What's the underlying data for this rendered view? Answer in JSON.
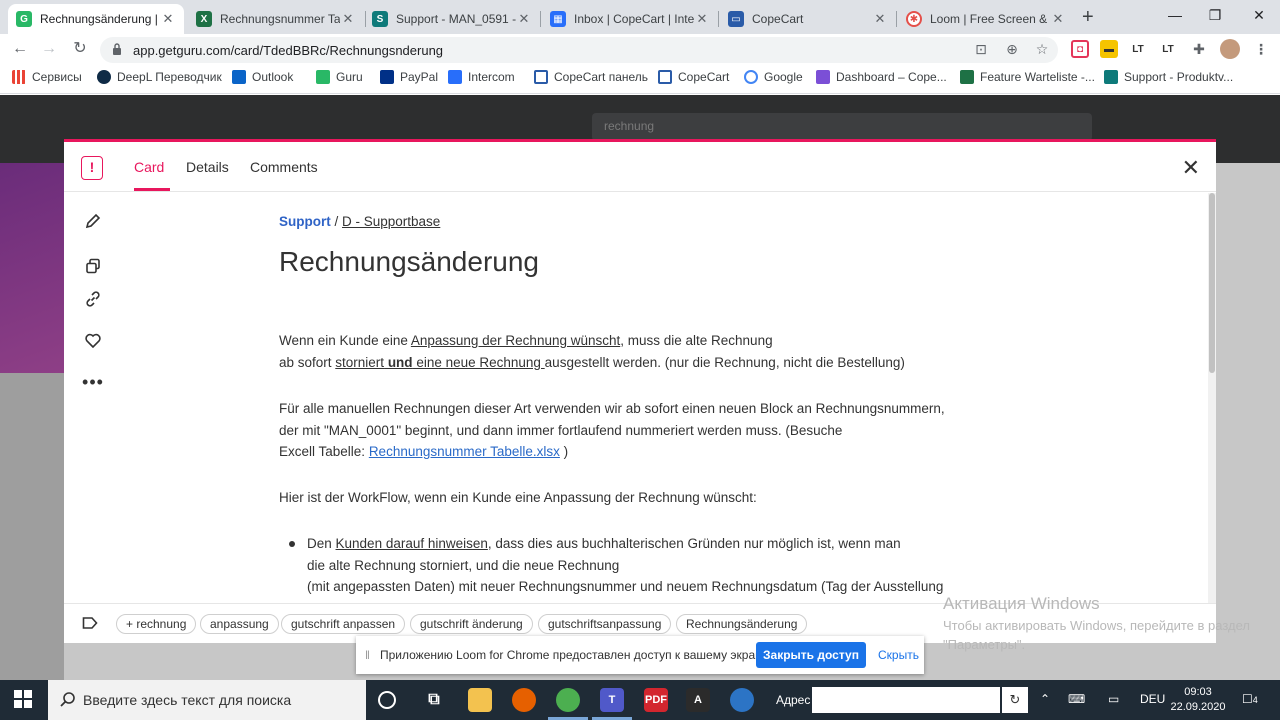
{
  "browser": {
    "tabs": [
      {
        "title": "Rechnungsänderung | G",
        "active": true,
        "icon": "guru-icon",
        "color": "#29b866"
      },
      {
        "title": "Rechnungsnummer Tab",
        "active": false,
        "icon": "excel-icon",
        "color": "#1e7145"
      },
      {
        "title": "Support - MAN_0591 -",
        "active": false,
        "icon": "sharepoint-icon",
        "color": "#0e7a7a"
      },
      {
        "title": "Inbox | CopeCart | Inter",
        "active": false,
        "icon": "intercom-icon",
        "color": "#286efa"
      },
      {
        "title": "CopeCart",
        "active": false,
        "icon": "copecart-icon",
        "color": "#2a5ba8"
      },
      {
        "title": "Loom | Free Screen & V",
        "active": false,
        "icon": "loom-icon",
        "color": "#e4504a"
      }
    ],
    "new_tab": "+",
    "url": "app.getguru.com/card/TdedBBRc/Rechnungsnderung",
    "bookmarks": [
      {
        "label": "Сервисы",
        "icon": "apps-icon"
      },
      {
        "label": "DeepL Переводчик",
        "icon": "deepl-icon"
      },
      {
        "label": "Outlook",
        "icon": "outlook-icon"
      },
      {
        "label": "Guru",
        "icon": "guru-icon"
      },
      {
        "label": "PayPal",
        "icon": "paypal-icon"
      },
      {
        "label": "Intercom",
        "icon": "intercom-icon"
      },
      {
        "label": "CopeCart панель",
        "icon": "copecart-icon"
      },
      {
        "label": "CopeCart",
        "icon": "copecart-icon"
      },
      {
        "label": "Google",
        "icon": "google-icon"
      },
      {
        "label": "Dashboard – Cope...",
        "icon": "dashboard-icon"
      },
      {
        "label": "Feature Warteliste -...",
        "icon": "excel-icon"
      },
      {
        "label": "Support - Produktv...",
        "icon": "sharepoint-icon"
      }
    ]
  },
  "app": {
    "search_value": "rechnung"
  },
  "card": {
    "tabs": [
      "Card",
      "Details",
      "Comments"
    ],
    "breadcrumb_collection": "Support",
    "breadcrumb_sep": " / ",
    "breadcrumb_board": "D - Supportbase",
    "title": "Rechnungsänderung",
    "p1": {
      "t1": "Wenn ein Kunde eine ",
      "u1": "Anpassung der Rechnung wünscht",
      "t2": ", muss die alte Rechnung",
      "t3": "ab sofort ",
      "u2": "storniert",
      "b1": " und",
      "u3": " eine neue Rechnung ",
      "t4": "ausgestellt werden. (nur die Rechnung, nicht die Bestellung)"
    },
    "p2": {
      "l1": "Für alle manuellen Rechnungen dieser Art verwenden wir ab sofort einen neuen Block an Rechnungsnummern,",
      "l2": "der mit \"MAN_0001\" beginnt, und dann immer fortlaufend nummeriert werden muss. (Besuche",
      "l3": "Excell Tabelle: ",
      "link": "Rechnungsnummer Tabelle.xlsx",
      "l3end": " )"
    },
    "p3": "Hier ist der WorkFlow, wenn ein Kunde eine Anpassung der Rechnung wünscht:",
    "bullet1": {
      "t1": "Den ",
      "u1": "Kunden darauf hinweisen",
      "t2": ", dass dies aus buchhalterischen Gründen nur möglich ist, wenn man",
      "l2": "die alte Rechnung storniert, und die neue Rechnung",
      "l3": "(mit angepassten Daten) mit neuer Rechnungsnummer und neuem Rechnungsdatum (Tag der Ausstellung"
    },
    "tags": [
      "+ rechnung",
      "anpassung",
      "gutschrift anpassen",
      "gutschrift änderung",
      "gutschriftsanpassung",
      "Rechnungsänderung"
    ],
    "accent": "#e8175d"
  },
  "loom": {
    "message": "Приложению Loom for Chrome предоставлен доступ к вашему экрану.",
    "stop": "Закрыть доступ",
    "hide": "Скрыть"
  },
  "watermark": {
    "title": "Активация Windows",
    "text": "Чтобы активировать Windows, перейдите в раздел \"Параметры\"."
  },
  "taskbar": {
    "search_placeholder": "Введите здесь текст для поиска",
    "address_label": "Адрес",
    "lang": "DEU",
    "time": "09:03",
    "date": "22.09.2020",
    "notifications": "4"
  }
}
